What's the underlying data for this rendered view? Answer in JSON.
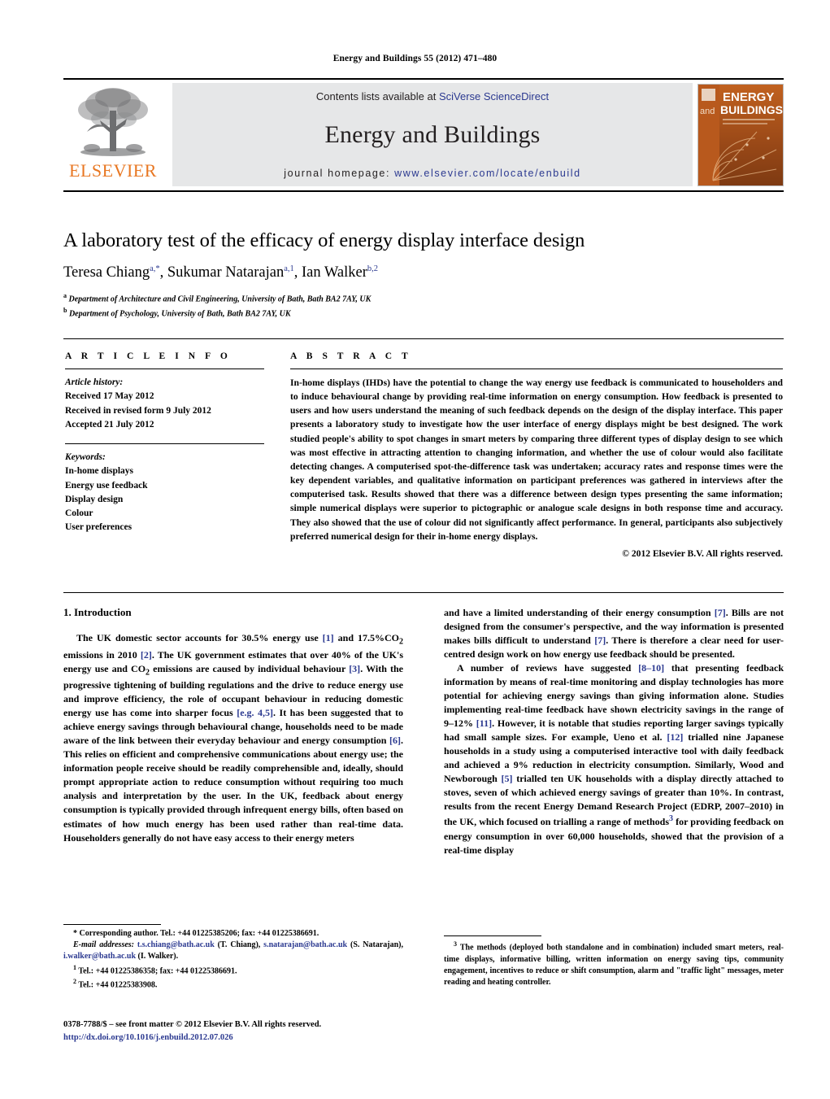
{
  "running_head": "Energy and Buildings 55 (2012) 471–480",
  "masthead": {
    "publisher_name": "ELSEVIER",
    "contents_prefix": "Contents lists available at ",
    "contents_link": "SciVerse ScienceDirect",
    "journal_name": "Energy and Buildings",
    "homepage_prefix": "journal homepage: ",
    "homepage_url": "www.elsevier.com/locate/enbuild",
    "cover_title_1": "ENERGY",
    "cover_title_2": "BUILDINGS",
    "cover_and": "and",
    "colors": {
      "accent_orange": "#E87722",
      "link_blue": "#2b3990",
      "band_grey": "#e6e7e8"
    }
  },
  "title": "A laboratory test of the efficacy of energy display interface design",
  "authors": {
    "a1_name": "Teresa Chiang",
    "a1_sup": "a,*",
    "sep1": ", ",
    "a2_name": "Sukumar Natarajan",
    "a2_sup": "a,1",
    "sep2": ", ",
    "a3_name": "Ian Walker",
    "a3_sup": "b,2"
  },
  "affiliations": [
    {
      "mark": "a",
      "text": "Department of Architecture and Civil Engineering, University of Bath, Bath BA2 7AY, UK"
    },
    {
      "mark": "b",
      "text": "Department of Psychology, University of Bath, Bath BA2 7AY, UK"
    }
  ],
  "article_info": {
    "heading": "A R T I C L E   I N F O",
    "history_label": "Article history:",
    "history": [
      "Received 17 May 2012",
      "Received in revised form 9 July 2012",
      "Accepted 21 July 2012"
    ],
    "keywords_label": "Keywords:",
    "keywords": [
      "In-home displays",
      "Energy use feedback",
      "Display design",
      "Colour",
      "User preferences"
    ]
  },
  "abstract": {
    "heading": "A B S T R A C T",
    "text": "In-home displays (IHDs) have the potential to change the way energy use feedback is communicated to householders and to induce behavioural change by providing real-time information on energy consumption. How feedback is presented to users and how users understand the meaning of such feedback depends on the design of the display interface. This paper presents a laboratory study to investigate how the user interface of energy displays might be best designed. The work studied people's ability to spot changes in smart meters by comparing three different types of display design to see which was most effective in attracting attention to changing information, and whether the use of colour would also facilitate detecting changes. A computerised spot-the-difference task was undertaken; accuracy rates and response times were the key dependent variables, and qualitative information on participant preferences was gathered in interviews after the computerised task. Results showed that there was a difference between design types presenting the same information; simple numerical displays were superior to pictographic or analogue scale designs in both response time and accuracy. They also showed that the use of colour did not significantly affect performance. In general, participants also subjectively preferred numerical design for their in-home energy displays.",
    "copyright": "© 2012 Elsevier B.V. All rights reserved."
  },
  "introduction": {
    "section_title": "1.  Introduction",
    "left_para_1_a": "The UK domestic sector accounts for 30.5% energy use ",
    "left_cit_1": "[1]",
    "left_para_1_b": " and 17.5%CO",
    "left_para_1_c": " emissions in 2010 ",
    "left_cit_2": "[2]",
    "left_para_1_d": ". The UK government estimates that over 40% of the UK's energy use and CO",
    "left_para_1_e": " emissions are caused by individual behaviour ",
    "left_cit_3": "[3]",
    "left_para_1_f": ". With the progressive tightening of building regulations and the drive to reduce energy use and improve efficiency, the role of occupant behaviour in reducing domestic energy use has come into sharper focus ",
    "left_cit_4": "[e.g. 4,5]",
    "left_para_1_g": ". It has been suggested that to achieve energy savings through behavioural change, households need to be made aware of the link between their everyday behaviour and energy consumption ",
    "left_cit_5": "[6]",
    "left_para_1_h": ". This relies on efficient and comprehensive communications about energy use; the information people receive should be readily comprehensible and, ideally, should prompt appropriate action to reduce consumption without requiring too much analysis and interpretation by the user. In the UK, feedback about energy consumption is typically provided through infrequent energy bills, often based on estimates of how much energy has been used rather than real-time data. Householders generally do not have easy access to their energy meters",
    "right_para_1_a": "and have a limited understanding of their energy consumption ",
    "right_cit_1": "[7]",
    "right_para_1_b": ". Bills are not designed from the consumer's perspective, and the way information is presented makes bills difficult to understand ",
    "right_cit_2": "[7]",
    "right_para_1_c": ". There is therefore a clear need for user-centred design work on how energy use feedback should be presented.",
    "right_para_2_a": "A number of reviews have suggested ",
    "right_cit_3": "[8–10]",
    "right_para_2_b": " that presenting feedback information by means of real-time monitoring and display technologies has more potential for achieving energy savings than giving information alone. Studies implementing real-time feedback have shown electricity savings in the range of 9–12% ",
    "right_cit_4": "[11]",
    "right_para_2_c": ". However, it is notable that studies reporting larger savings typically had small sample sizes. For example, Ueno et al. ",
    "right_cit_5": "[12]",
    "right_para_2_d": " trialled nine Japanese households in a study using a computerised interactive tool with daily feedback and achieved a 9% reduction in electricity consumption. Similarly, Wood and Newborough ",
    "right_cit_6": "[5]",
    "right_para_2_e": " trialled ten UK households with a display directly attached to stoves, seven of which achieved energy savings of greater than 10%. In contrast, results from the recent Energy Demand Research Project (EDRP, 2007–2010) in the UK, which focused on trialling a range of methods",
    "right_fn_mark": "3",
    "right_para_2_f": " for providing feedback on energy consumption in over 60,000 households, showed that the provision of a real-time display"
  },
  "footnotes": {
    "corresponding": "*  Corresponding author. Tel.: +44 01225385206; fax: +44 01225386691.",
    "email_label": "E-mail addresses:",
    "email_1": "t.s.chiang@bath.ac.uk",
    "email_1_who": " (T. Chiang), ",
    "email_2": "s.natarajan@bath.ac.uk",
    "email_2_who": " (S. Natarajan), ",
    "email_3": "i.walker@bath.ac.uk",
    "email_3_who": " (I. Walker).",
    "note_1_mark": "1",
    "note_1": " Tel.: +44 01225386358; fax: +44 01225386691.",
    "note_2_mark": "2",
    "note_2": " Tel.: +44 01225383908.",
    "note_3_mark": "3",
    "note_3": " The methods (deployed both standalone and in combination) included smart meters, real-time displays, informative billing, written information on energy saving tips, community engagement, incentives to reduce or shift consumption, alarm and \"traffic light\" messages, meter reading and heating controller."
  },
  "imprint": {
    "issn_line": "0378-7788/$ – see front matter © 2012 Elsevier B.V. All rights reserved.",
    "doi": "http://dx.doi.org/10.1016/j.enbuild.2012.07.026"
  }
}
